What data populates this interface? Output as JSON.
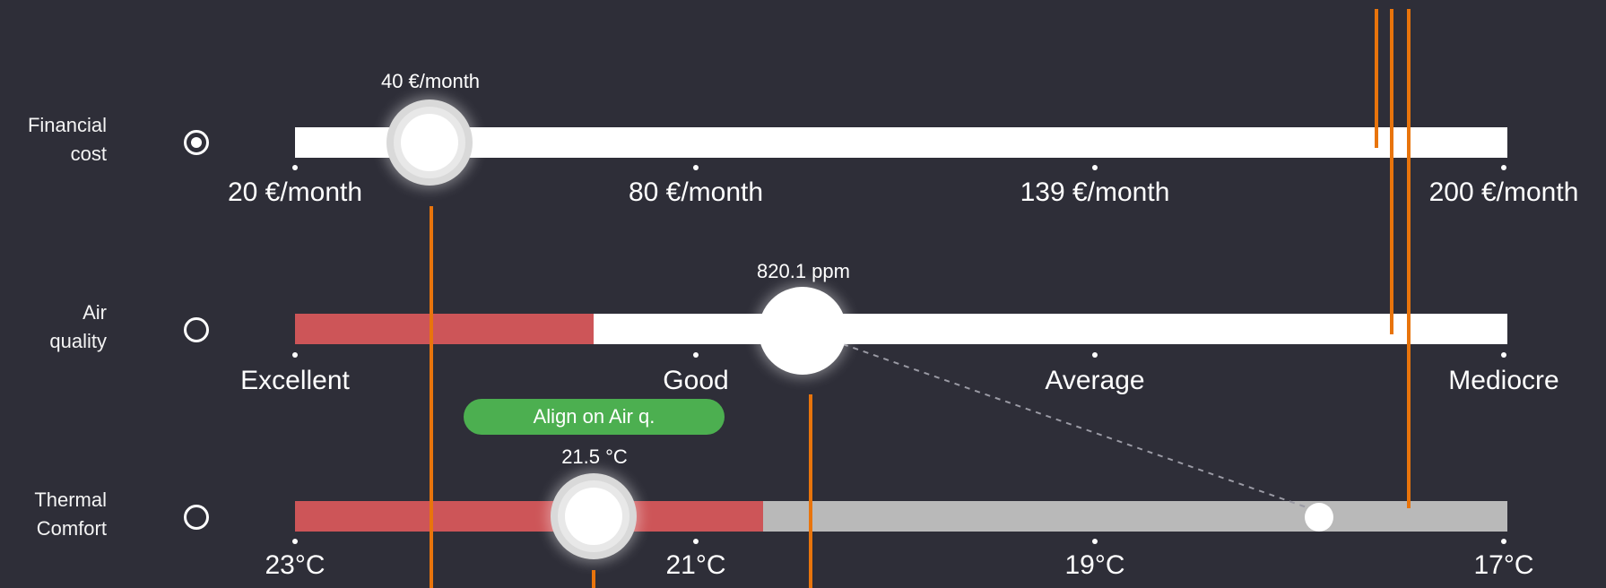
{
  "colors": {
    "background": "#2e2e38",
    "track": "#ffffff",
    "fill_red": "#cd5558",
    "fill_grey": "#b9b9b9",
    "button_green": "#4caf50",
    "annotation_orange": "#e8740c"
  },
  "sliders": [
    {
      "label_line1": "Financial",
      "label_line2": "cost",
      "selected": true,
      "value_label": "40 €/month",
      "value_fraction": 0.112,
      "ticks": [
        "20 €/month",
        "80 €/month",
        "139 €/month",
        "200 €/month"
      ]
    },
    {
      "label_line1": "Air",
      "label_line2": "quality",
      "selected": false,
      "value_label": "820.1 ppm",
      "value_fraction": 0.42,
      "red_fill_fraction": 0.246,
      "ticks": [
        "Excellent",
        "Good",
        "Average",
        "Mediocre"
      ]
    },
    {
      "label_line1": "Thermal",
      "label_line2": "Comfort",
      "selected": false,
      "value_label": "21.5 °C",
      "value_fraction": 0.247,
      "red_fill_fraction": 0.386,
      "linked_fraction": 0.846,
      "ticks": [
        "23°C",
        "21°C",
        "19°C",
        "17°C"
      ]
    }
  ],
  "align_button": {
    "label": "Align on Air q."
  }
}
